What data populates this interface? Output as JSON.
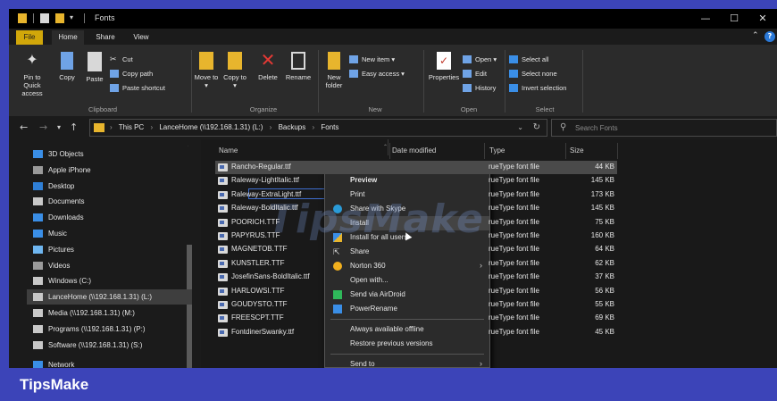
{
  "window": {
    "title": "Fonts",
    "qat_dropdown": "▾"
  },
  "ribbon_tabs": [
    "File",
    "Home",
    "Share",
    "View"
  ],
  "ribbon": {
    "clipboard": {
      "label": "Clipboard",
      "pin": "Pin to Quick access",
      "copy": "Copy",
      "paste": "Paste",
      "cut": "Cut",
      "copy_path": "Copy path",
      "paste_shortcut": "Paste shortcut"
    },
    "organize": {
      "label": "Organize",
      "move_to": "Move to ▾",
      "copy_to": "Copy to ▾",
      "delete": "Delete",
      "rename": "Rename"
    },
    "new": {
      "label": "New",
      "new_folder": "New folder",
      "new_item": "New item ▾",
      "easy_access": "Easy access ▾"
    },
    "open": {
      "label": "Open",
      "properties": "Properties",
      "open": "Open ▾",
      "edit": "Edit",
      "history": "History"
    },
    "select": {
      "label": "Select",
      "select_all": "Select all",
      "select_none": "Select none",
      "invert": "Invert selection"
    }
  },
  "address": {
    "crumbs": [
      "This PC",
      "LanceHome (\\\\192.168.1.31) (L:)",
      "Backups",
      "Fonts"
    ],
    "search_placeholder": "Search Fonts"
  },
  "nav_items": [
    {
      "label": "3D Objects",
      "color": "#3a8ee6"
    },
    {
      "label": "Apple iPhone",
      "color": "#9a9a9a"
    },
    {
      "label": "Desktop",
      "color": "#2f7fd6"
    },
    {
      "label": "Documents",
      "color": "#c8c8c8"
    },
    {
      "label": "Downloads",
      "color": "#3a8ee6"
    },
    {
      "label": "Music",
      "color": "#3a8ee6"
    },
    {
      "label": "Pictures",
      "color": "#6fb6f0"
    },
    {
      "label": "Videos",
      "color": "#9a9a9a"
    },
    {
      "label": "Windows (C:)",
      "color": "#c8c8c8"
    },
    {
      "label": "LanceHome (\\\\192.168.1.31) (L:)",
      "color": "#c8c8c8"
    },
    {
      "label": "Media (\\\\192.168.1.31) (M:)",
      "color": "#c8c8c8"
    },
    {
      "label": "Programs (\\\\192.168.1.31) (P:)",
      "color": "#c8c8c8"
    },
    {
      "label": "Software (\\\\192.168.1.31) (S:)",
      "color": "#c8c8c8"
    },
    {
      "label": "Network",
      "color": "#3a8ee6"
    }
  ],
  "columns": {
    "name": "Name",
    "date": "Date modified",
    "type": "Type",
    "size": "Size"
  },
  "files": [
    {
      "name": "Rancho-Regular.ttf",
      "type": "rueType font file",
      "size": "44 KB"
    },
    {
      "name": "Raleway-LightItalic.ttf",
      "type": "rueType font file",
      "size": "145 KB"
    },
    {
      "name": "Raleway-ExtraLight.ttf",
      "type": "rueType font file",
      "size": "173 KB"
    },
    {
      "name": "Raleway-BoldItalic.ttf",
      "type": "rueType font file",
      "size": "145 KB"
    },
    {
      "name": "POORICH.TTF",
      "type": "rueType font file",
      "size": "75 KB"
    },
    {
      "name": "PAPYRUS.TTF",
      "type": "rueType font file",
      "size": "160 KB"
    },
    {
      "name": "MAGNETOB.TTF",
      "type": "rueType font file",
      "size": "64 KB"
    },
    {
      "name": "KUNSTLER.TTF",
      "type": "rueType font file",
      "size": "62 KB"
    },
    {
      "name": "JosefinSans-BoldItalic.ttf",
      "type": "rueType font file",
      "size": "37 KB"
    },
    {
      "name": "HARLOWSI.TTF",
      "type": "rueType font file",
      "size": "56 KB"
    },
    {
      "name": "GOUDYSTO.TTF",
      "type": "rueType font file",
      "size": "55 KB"
    },
    {
      "name": "FREESCPT.TTF",
      "type": "rueType font file",
      "size": "69 KB"
    },
    {
      "name": "FontdinerSwanky.ttf",
      "type": "rueType font file",
      "size": "45 KB"
    }
  ],
  "context_menu": {
    "preview": "Preview",
    "print": "Print",
    "share_skype": "Share with Skype",
    "install": "Install",
    "install_all": "Install for all users",
    "share": "Share",
    "norton": "Norton 360",
    "open_with": "Open with...",
    "airdroid": "Send via AirDroid",
    "powerrename": "PowerRename",
    "always_offline": "Always available offline",
    "restore": "Restore previous versions",
    "send_to": "Send to"
  },
  "watermark": "TipsMake",
  "footer_brand": "TipsMake",
  "colors": {
    "accent": "#3c44b8",
    "folder": "#e8b52d",
    "file_tab": "#d1a70a"
  }
}
